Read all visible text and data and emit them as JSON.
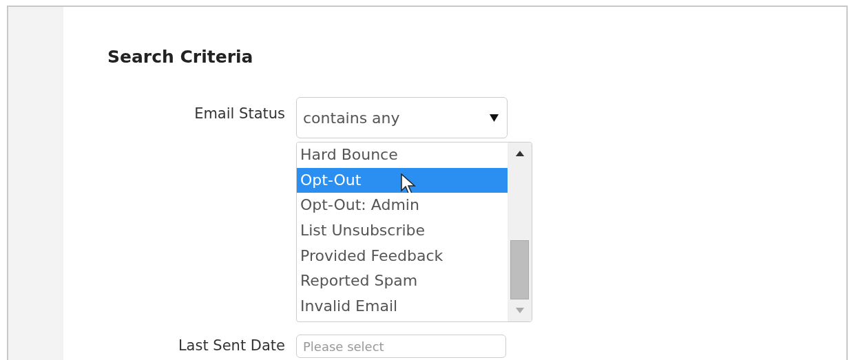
{
  "heading": "Search Criteria",
  "fields": [
    {
      "kind": "multiselect",
      "label": "Email Status",
      "operator": "contains any",
      "options": [
        {
          "label": "Hard Bounce",
          "selected": false
        },
        {
          "label": "Opt-Out",
          "selected": true
        },
        {
          "label": "Opt-Out: Admin",
          "selected": false
        },
        {
          "label": "List Unsubscribe",
          "selected": false
        },
        {
          "label": "Provided Feedback",
          "selected": false
        },
        {
          "label": "Reported Spam",
          "selected": false
        },
        {
          "label": "Invalid Email",
          "selected": false
        }
      ]
    },
    {
      "kind": "date",
      "label": "Last Sent Date",
      "placeholder": "Please select"
    }
  ]
}
